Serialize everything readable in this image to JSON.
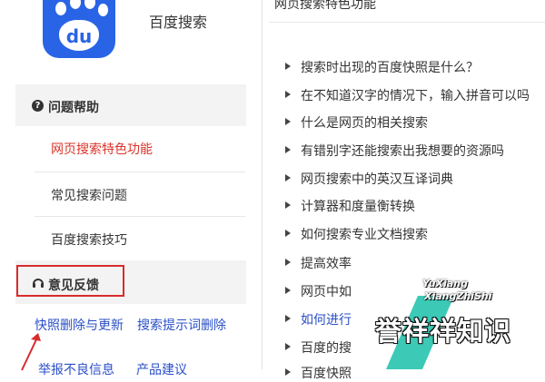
{
  "colors": {
    "brand_blue": "#2a64e6",
    "active_red": "#d9342b",
    "link_blue": "#2a4fc7",
    "watermark_teal": "#3ccab6"
  },
  "app": {
    "title": "百度搜索",
    "logo_text": "du"
  },
  "sidebar": {
    "help_header": "问题帮助",
    "help_items": [
      {
        "label": "网页搜索特色功能",
        "active": true
      },
      {
        "label": "常见搜索问题",
        "active": false
      },
      {
        "label": "百度搜索技巧",
        "active": false
      }
    ],
    "feedback_header": "意见反馈",
    "feedback_links": [
      "快照删除与更新",
      "搜索提示词删除",
      "举报不良信息",
      "产品建议"
    ]
  },
  "main": {
    "title": "网页搜索特色功能",
    "items": [
      "搜索时出现的百度快照是什么？",
      "在不知道汉字的情况下，输入拼音可以吗",
      "什么是网页的相关搜索",
      "有错别字还能搜索出我想要的资源吗",
      "网页搜索中的英汉互译词典",
      "计算器和度量衡转换",
      "如何搜索专业文档搜索",
      "提高效率",
      "网页中如",
      "如何进行",
      "百度的搜",
      "百度快照"
    ]
  },
  "watermark": {
    "line1": "YuXiang",
    "line2": "XiangZhiShi",
    "main": "誉祥祥知识"
  }
}
